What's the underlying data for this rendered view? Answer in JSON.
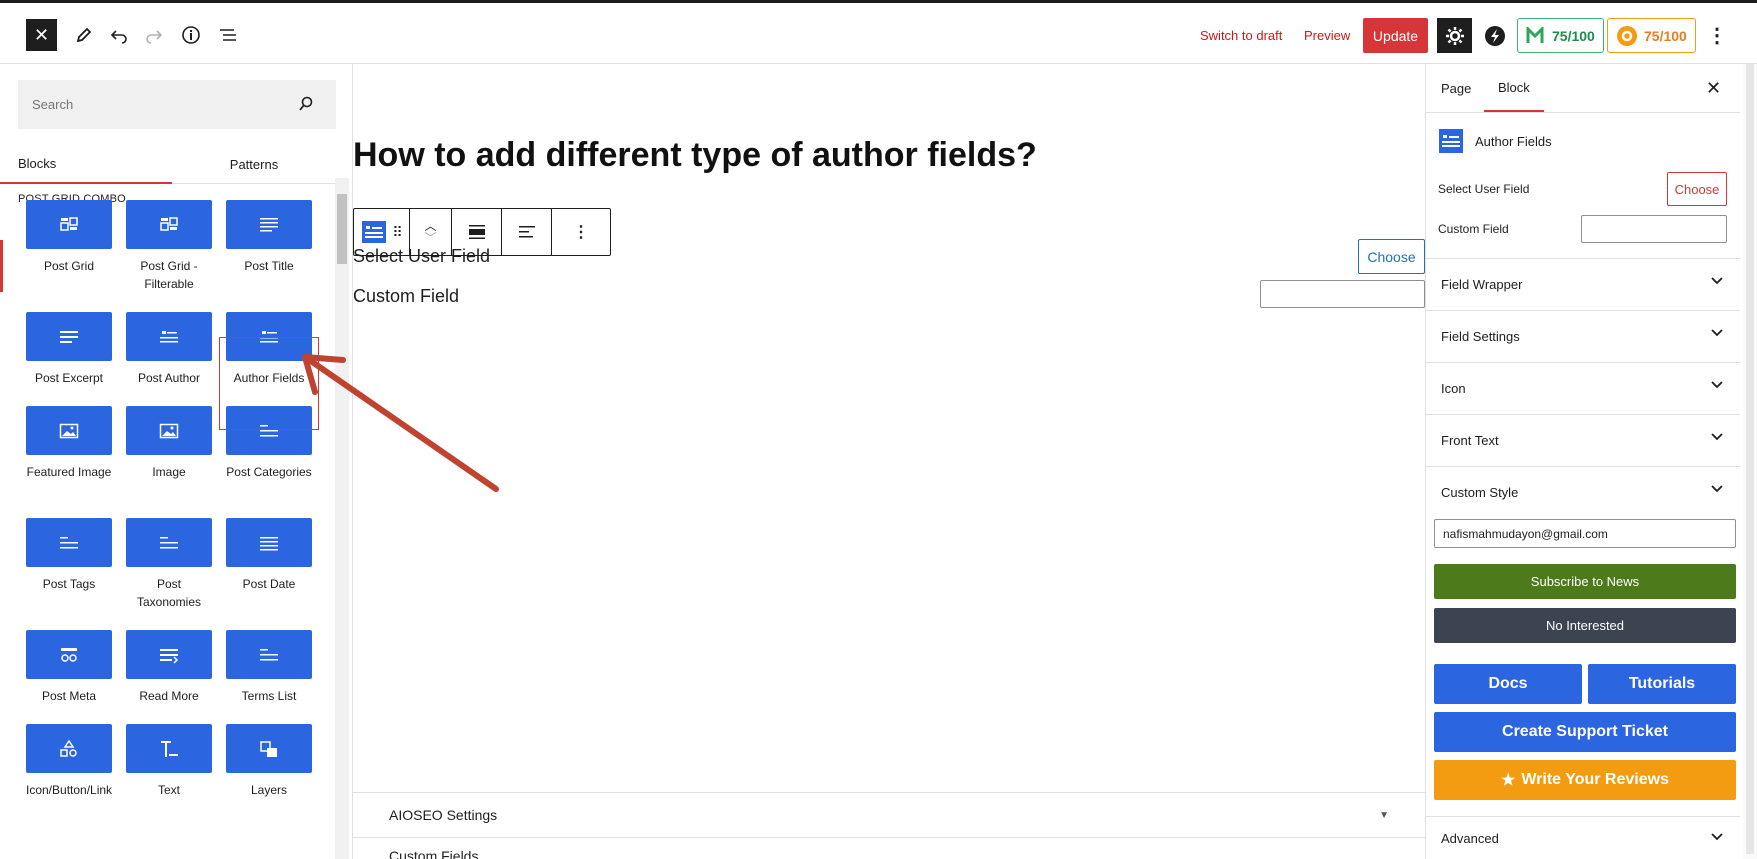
{
  "topbar": {
    "switch_to_draft": "Switch to draft",
    "preview": "Preview",
    "update": "Update",
    "score_green": "75/100",
    "score_orange": "75/100"
  },
  "left": {
    "search_placeholder": "Search",
    "tabs": [
      "Blocks",
      "Patterns"
    ],
    "category": "POST GRID COMBO",
    "blocks": [
      {
        "label": "Post Grid",
        "icon": "grid-icon"
      },
      {
        "label": "Post Grid - Filterable",
        "icon": "grid-icon"
      },
      {
        "label": "Post Title",
        "icon": "heading-icon"
      },
      {
        "label": "Post Excerpt",
        "icon": "paragraph-icon"
      },
      {
        "label": "Post Author",
        "icon": "author-icon"
      },
      {
        "label": "Author Fields",
        "icon": "author-fields-icon"
      },
      {
        "label": "Featured Image",
        "icon": "image-icon"
      },
      {
        "label": "Image",
        "icon": "image-icon"
      },
      {
        "label": "Post Categories",
        "icon": "list-icon"
      },
      {
        "label": "Post Tags",
        "icon": "list-icon"
      },
      {
        "label": "Post Taxonomies",
        "icon": "list-icon"
      },
      {
        "label": "Post Date",
        "icon": "text-lines-icon"
      },
      {
        "label": "Post Meta",
        "icon": "meta-icon"
      },
      {
        "label": "Read More",
        "icon": "read-more-icon"
      },
      {
        "label": "Terms List",
        "icon": "list-icon"
      },
      {
        "label": "Icon/Button/Link",
        "icon": "shapes-icon"
      },
      {
        "label": "Text",
        "icon": "text-icon"
      },
      {
        "label": "Layers",
        "icon": "layers-icon"
      }
    ]
  },
  "main": {
    "title": "How to add different type of author fields?",
    "select_user_field": "Select User Field",
    "choose": "Choose",
    "custom_field": "Custom Field",
    "aioseo": "AIOSEO Settings",
    "custom_fields": "Custom Fields"
  },
  "right": {
    "tabs": [
      "Page",
      "Block"
    ],
    "block_name": "Author Fields",
    "select_user_field": "Select User Field",
    "choose": "Choose",
    "custom_field": "Custom Field",
    "panels": [
      "Field Wrapper",
      "Field Settings",
      "Icon",
      "Front Text",
      "Custom Style"
    ],
    "email_value": "nafismahmudayon@gmail.com",
    "subscribe": "Subscribe to News",
    "no_interested": "No Interested",
    "docs": "Docs",
    "tutorials": "Tutorials",
    "support": "Create Support Ticket",
    "reviews": "Write Your Reviews",
    "advanced": "Advanced"
  },
  "colors": {
    "accent_red": "#d63638",
    "block_blue": "#2b65e0",
    "green_subscribe": "#4d7a1b",
    "dark_no": "#3c4452",
    "orange_review": "#f39c12",
    "arrow": "#c0432f"
  }
}
